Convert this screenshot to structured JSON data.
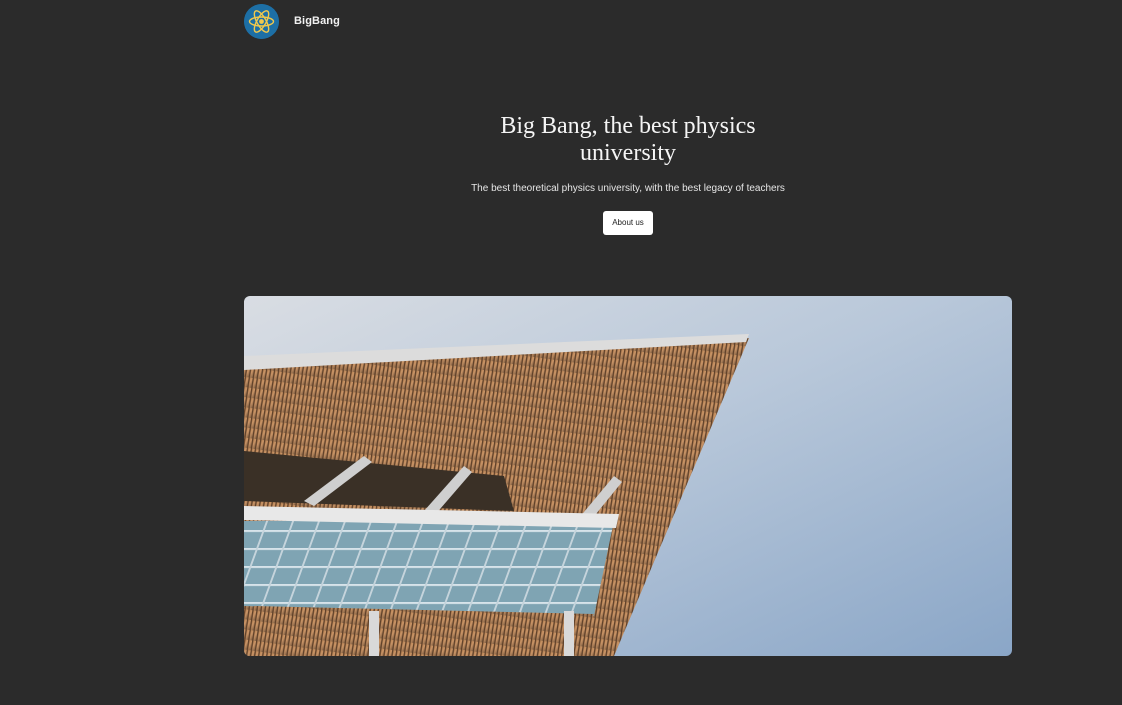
{
  "header": {
    "brand": "BigBang",
    "logo_icon": "atom-icon"
  },
  "hero": {
    "title": "Big Bang, the best physics university",
    "subtitle": "The best theoretical physics university, with the best legacy of teachers",
    "cta_label": "About us"
  },
  "photo": {
    "subject": "university-building-photo"
  },
  "colors": {
    "background": "#2b2b2b",
    "logo_bg": "#1d6fa5",
    "text": "#f2f2f2"
  }
}
